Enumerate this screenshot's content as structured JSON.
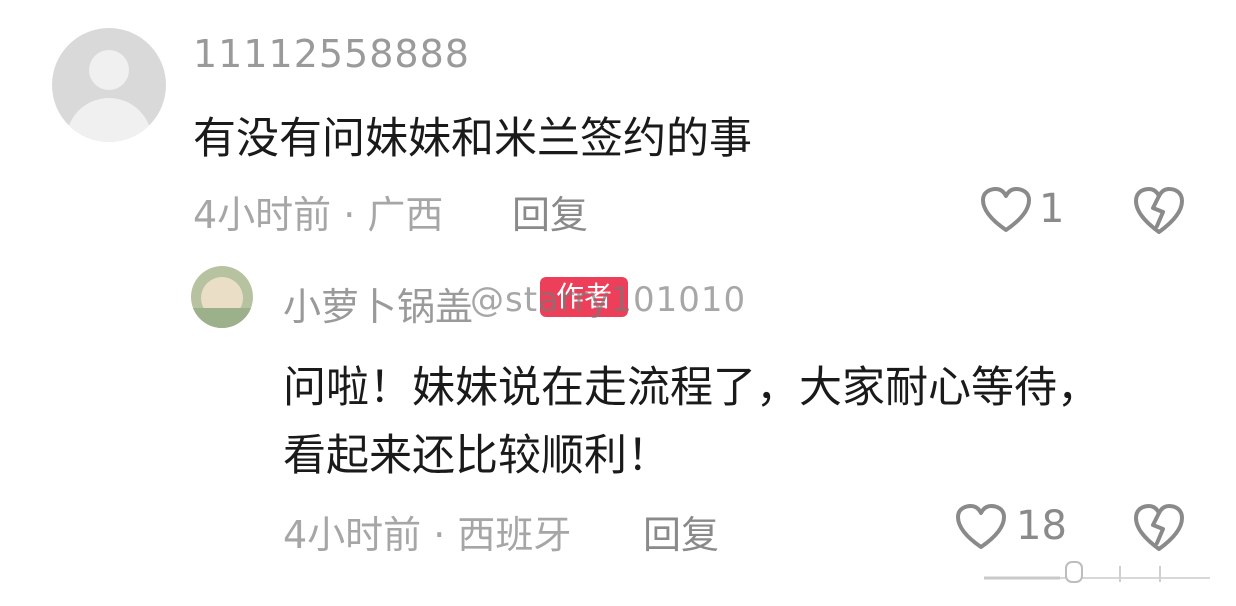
{
  "comment": {
    "username": "11112558888",
    "text": "有没有问妹妹和米兰签约的事",
    "meta": "4小时前 · 广西",
    "reply_label": "回复",
    "likes": "1"
  },
  "reply": {
    "username": "小萝卜锅盖",
    "badge": "作者",
    "text": "问啦！妹妹说在走流程了，大家耐心等待，",
    "text_line2": "看起来还比较顺利！",
    "meta": "4小时前 · 西班牙",
    "reply_label": "回复",
    "likes": "18"
  },
  "watermark": "@starry101010",
  "icons": {
    "avatar": "default-avatar-icon",
    "heart": "heart-icon",
    "dislike": "broken-heart-icon"
  }
}
